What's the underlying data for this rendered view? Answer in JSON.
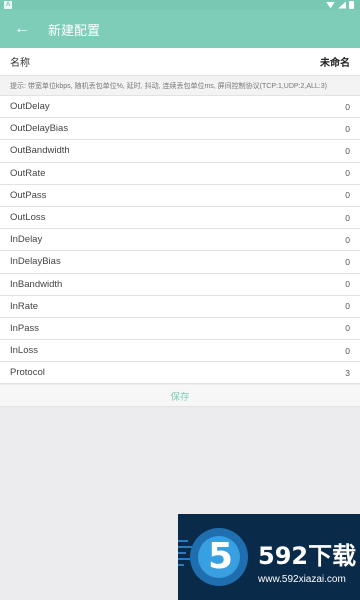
{
  "statusbar": {
    "left_icon": "A"
  },
  "appbar": {
    "back_icon": "←",
    "title": "新建配置"
  },
  "name_field": {
    "label": "名称",
    "value": "未命名"
  },
  "hint": "提示: 带宽单位kbps, 随机丢包单位%, 延时, 抖动, 连续丢包单位ms, 屏间控制协议(TCP:1,UDP:2,ALL:3)",
  "fields": [
    {
      "label": "OutDelay",
      "value": "0"
    },
    {
      "label": "OutDelayBias",
      "value": "0"
    },
    {
      "label": "OutBandwidth",
      "value": "0"
    },
    {
      "label": "OutRate",
      "value": "0"
    },
    {
      "label": "OutPass",
      "value": "0"
    },
    {
      "label": "OutLoss",
      "value": "0"
    },
    {
      "label": "InDelay",
      "value": "0"
    },
    {
      "label": "InDelayBias",
      "value": "0"
    },
    {
      "label": "InBandwidth",
      "value": "0"
    },
    {
      "label": "InRate",
      "value": "0"
    },
    {
      "label": "InPass",
      "value": "0"
    },
    {
      "label": "InLoss",
      "value": "0"
    },
    {
      "label": "Protocol",
      "value": "3"
    }
  ],
  "save_label": "保存",
  "watermark": {
    "digit": "5",
    "name": "592下载",
    "url": "www.592xiazai.com"
  },
  "colors": {
    "accent": "#7dcdb9",
    "background": "#ececee"
  }
}
